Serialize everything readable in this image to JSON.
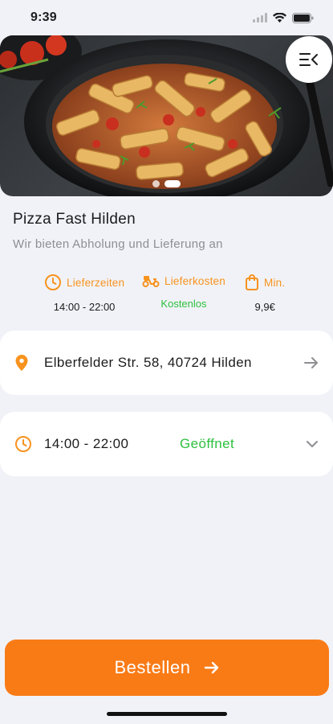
{
  "status_bar": {
    "time": "9:39",
    "icons": [
      "cellular-signal-icon",
      "wifi-icon",
      "battery-icon"
    ]
  },
  "hero": {
    "image": "pasta-dish-photo",
    "slide_count": 2,
    "active_slide": 2
  },
  "menu_button_icon": "menu-icon",
  "restaurant": {
    "name": "Pizza Fast Hilden",
    "tagline": "Wir bieten Abholung und Lieferung an"
  },
  "info": {
    "delivery_times": {
      "label": "Lieferzeiten",
      "value": "14:00 - 22:00",
      "icon": "clock-icon"
    },
    "delivery_costs": {
      "label": "Lieferkosten",
      "value": "Kostenlos",
      "icon": "scooter-icon"
    },
    "minimum": {
      "label": "Min.",
      "value": "9,9€",
      "icon": "shopping-bag-icon"
    }
  },
  "address_card": {
    "text": "Elberfelder Str. 58, 40724 Hilden",
    "icon": "location-pin-icon",
    "trail_icon": "arrow-right-icon"
  },
  "hours_card": {
    "time": "14:00 - 22:00",
    "status": "Geöffnet",
    "icon": "clock-icon",
    "trail_icon": "chevron-down-icon"
  },
  "order_button": {
    "label": "Bestellen",
    "icon": "arrow-right-icon"
  },
  "colors": {
    "accent": "#f97b16",
    "info_orange": "#f7931e",
    "open_green": "#2ec03f",
    "background": "#f1f2f7"
  }
}
